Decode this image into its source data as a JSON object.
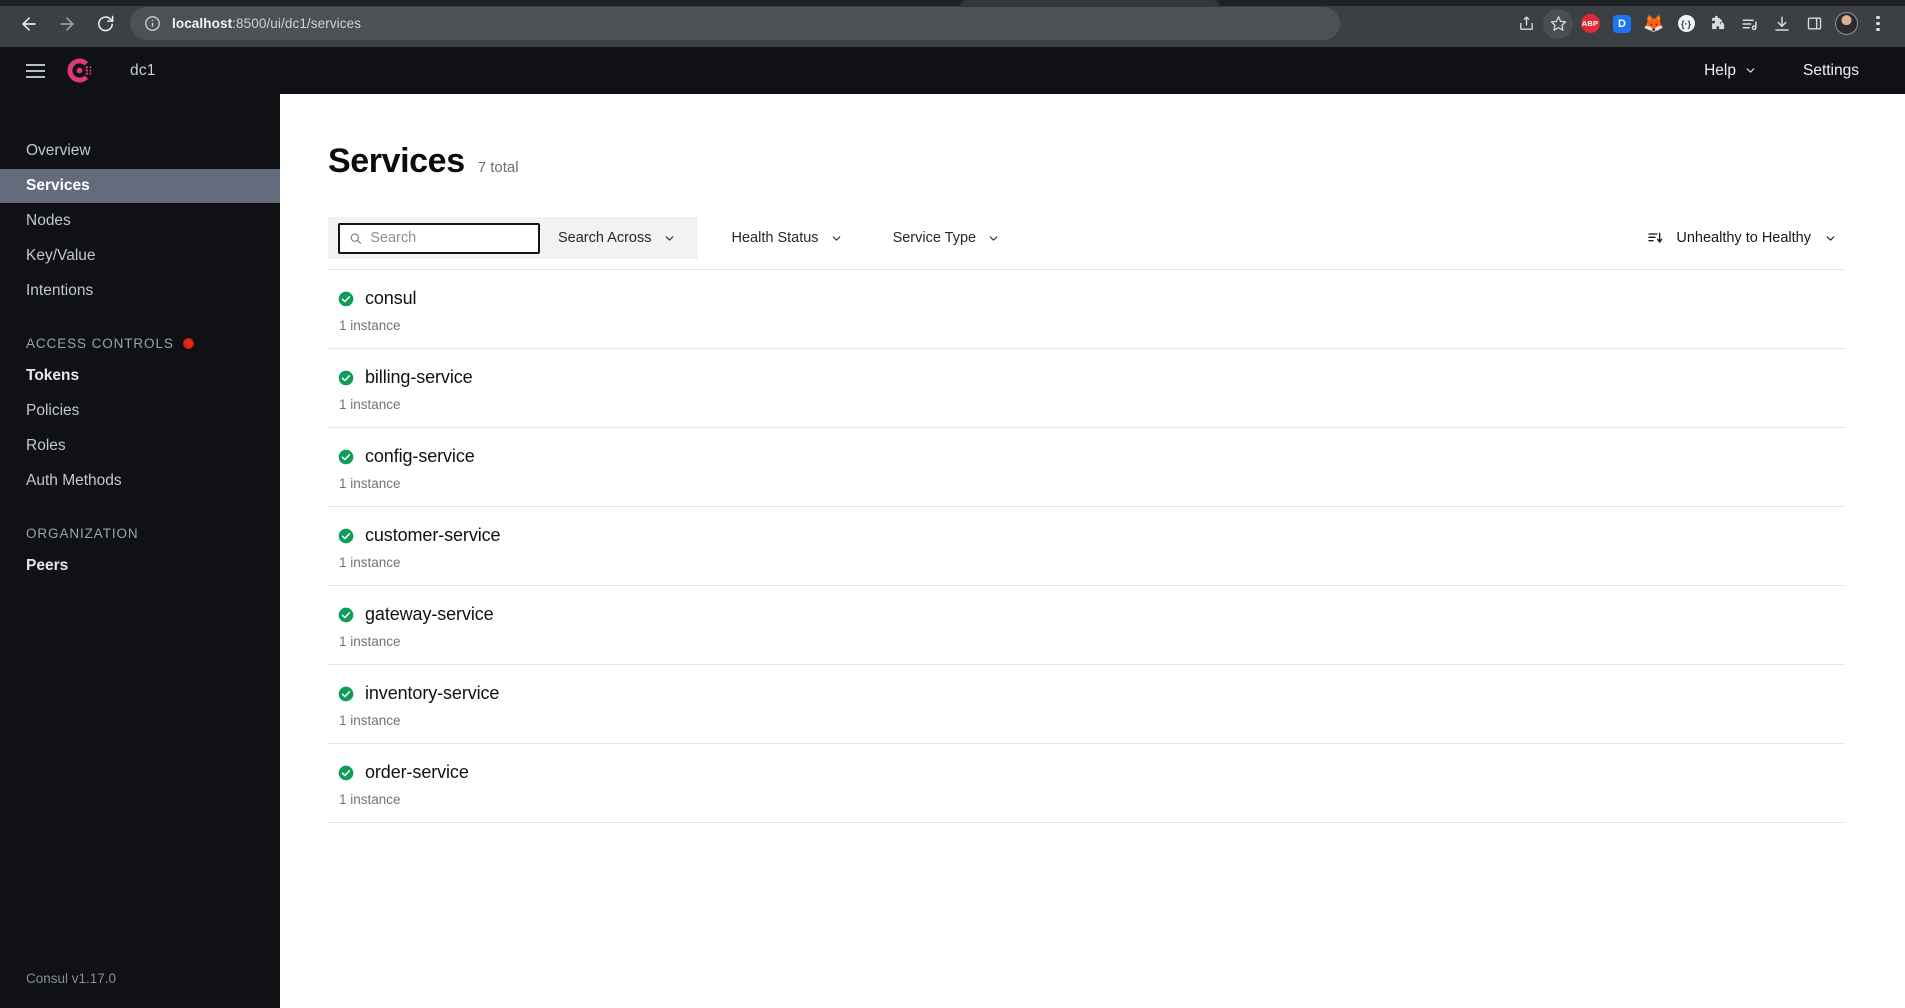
{
  "browser": {
    "back_icon": "back-arrow-icon",
    "forward_icon": "forward-arrow-icon",
    "reload_icon": "reload-icon",
    "site_info_icon": "info-circle-icon",
    "url_host": "localhost",
    "url_path": ":8500/ui/dc1/services",
    "url_full": "localhost:8500/ui/dc1/services",
    "actions": {
      "share_icon": "share-icon",
      "bookmark_icon": "star-icon",
      "ext_adblock_label": "ABP",
      "ext_dashlane_label": "D",
      "ext_fox_glyph": "🦊",
      "ext_circle_label": "{·}",
      "extensions_icon": "puzzle-piece-icon",
      "reading_list_icon": "reading-list-icon",
      "downloads_icon": "download-icon",
      "side_panel_icon": "side-panel-icon",
      "profile_icon": "avatar-icon",
      "menu_icon": "three-dot-menu-icon"
    }
  },
  "app": {
    "brand": {
      "logo_icon": "consul-logo-icon",
      "menu_icon": "hamburger-menu-icon",
      "datacenter": "dc1"
    },
    "topbar": {
      "help_label": "Help",
      "help_chevron_icon": "chevron-down-icon",
      "settings_label": "Settings"
    },
    "sidebar": {
      "items": [
        {
          "label": "Overview",
          "active": false,
          "bold": false
        },
        {
          "label": "Services",
          "active": true,
          "bold": false
        },
        {
          "label": "Nodes",
          "active": false,
          "bold": false
        },
        {
          "label": "Key/Value",
          "active": false,
          "bold": false
        },
        {
          "label": "Intentions",
          "active": false,
          "bold": false
        }
      ],
      "access_controls": {
        "title": "ACCESS CONTROLS",
        "badge_icon": "red-dot-badge-icon",
        "items": [
          {
            "label": "Tokens",
            "bold": true
          },
          {
            "label": "Policies",
            "bold": false
          },
          {
            "label": "Roles",
            "bold": false
          },
          {
            "label": "Auth Methods",
            "bold": false
          }
        ]
      },
      "organization": {
        "title": "ORGANIZATION",
        "items": [
          {
            "label": "Peers",
            "bold": true
          }
        ]
      },
      "version": "Consul v1.17.0"
    },
    "page": {
      "title": "Services",
      "count_label": "7 total",
      "filters": {
        "search_icon": "search-icon",
        "search_value": "",
        "search_placeholder": "Search",
        "search_across_label": "Search Across",
        "health_status_label": "Health Status",
        "service_type_label": "Service Type",
        "chevron_icon": "chevron-down-icon",
        "sort_icon": "sort-descending-icon",
        "sort_label": "Unhealthy to Healthy"
      },
      "services": [
        {
          "name": "consul",
          "instances": "1 instance",
          "health": "passing",
          "health_icon": "check-circle-icon"
        },
        {
          "name": "billing-service",
          "instances": "1 instance",
          "health": "passing",
          "health_icon": "check-circle-icon"
        },
        {
          "name": "config-service",
          "instances": "1 instance",
          "health": "passing",
          "health_icon": "check-circle-icon"
        },
        {
          "name": "customer-service",
          "instances": "1 instance",
          "health": "passing",
          "health_icon": "check-circle-icon"
        },
        {
          "name": "gateway-service",
          "instances": "1 instance",
          "health": "passing",
          "health_icon": "check-circle-icon"
        },
        {
          "name": "inventory-service",
          "instances": "1 instance",
          "health": "passing",
          "health_icon": "check-circle-icon"
        },
        {
          "name": "order-service",
          "instances": "1 instance",
          "health": "passing",
          "health_icon": "check-circle-icon"
        }
      ]
    }
  },
  "colors": {
    "brand_pink": "#e03875",
    "sidebar_bg": "#0f1114",
    "active_nav_bg": "#646b7d",
    "health_green": "#0f9d58",
    "badge_red": "#e0281d"
  }
}
